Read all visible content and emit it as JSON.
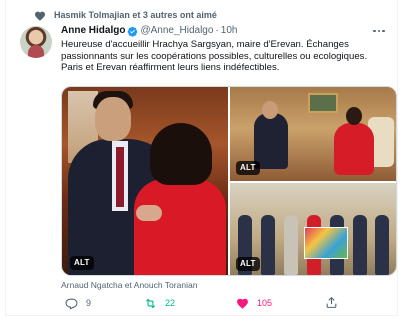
{
  "social_context": {
    "text": "Hasmik Tolmajian et 3 autres ont aimé",
    "icon": "heart-icon"
  },
  "author": {
    "name": "Anne Hidalgo",
    "verified": true,
    "handle": "@Anne_Hidalgo",
    "separator": "·",
    "time": "10h"
  },
  "tweet": {
    "lines": [
      "Heureuse d'accueillir Hrachya Sargsyan, maire d'Erevan. Échanges",
      "passionnants sur les coopérations possibles, culturelles ou ecologiques.",
      "Paris et Erevan réaffirment leurs liens indéfectibles."
    ]
  },
  "media": {
    "alt_badges": [
      "ALT",
      "ALT",
      "ALT"
    ],
    "caption": "Arnaud Ngatcha et Anouch Toranian"
  },
  "actions": {
    "reply_count": "9",
    "retweet_count": "22",
    "like_count": "105",
    "liked": true,
    "retweeted": true
  },
  "colors": {
    "like": "#f91880",
    "retweet": "#00ba7c",
    "verified": "#1d9bf0",
    "muted": "#536471"
  }
}
